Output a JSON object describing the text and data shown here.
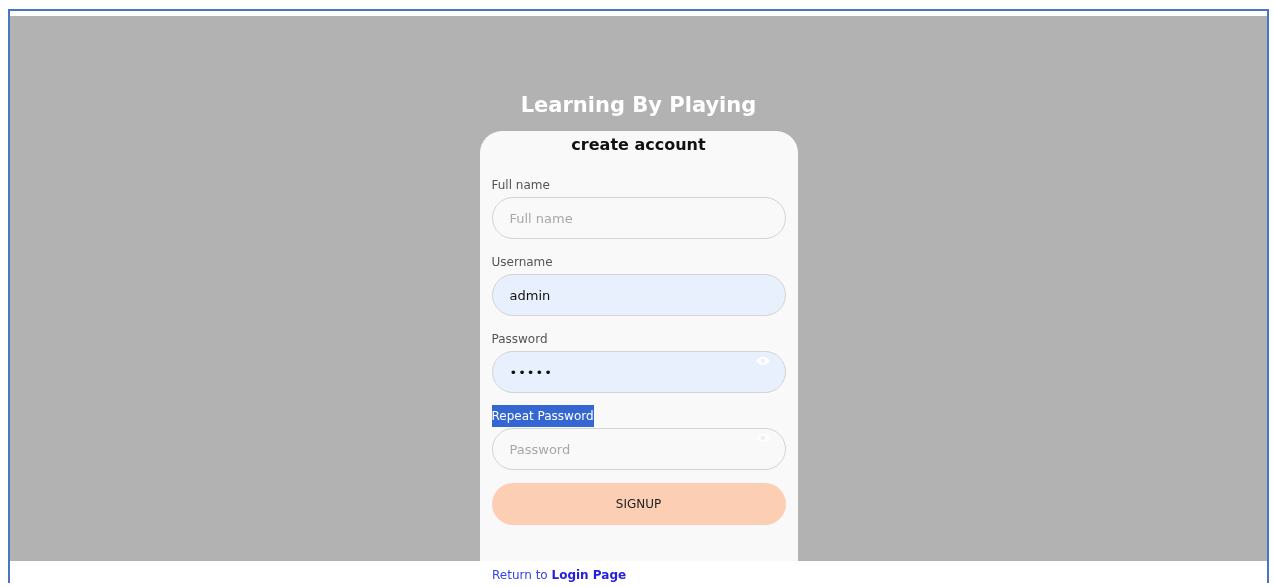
{
  "title": "Learning By Playing",
  "card": {
    "heading": "create account",
    "fields": [
      {
        "label": "Full name",
        "placeholder": "Full name",
        "kind": "text",
        "autofilled": false,
        "label_highlighted": false
      },
      {
        "label": "Username",
        "value": "admin",
        "kind": "text",
        "autofilled": true,
        "label_highlighted": false
      },
      {
        "label": "Password",
        "value": "•••••",
        "kind": "password",
        "autofilled": true,
        "label_highlighted": false
      },
      {
        "label": "Repeat Password",
        "placeholder": "Password",
        "kind": "password",
        "autofilled": false,
        "label_highlighted": true
      }
    ],
    "button": "SIGNUP"
  },
  "footer": {
    "text": "Return to",
    "link": "Login Page"
  }
}
